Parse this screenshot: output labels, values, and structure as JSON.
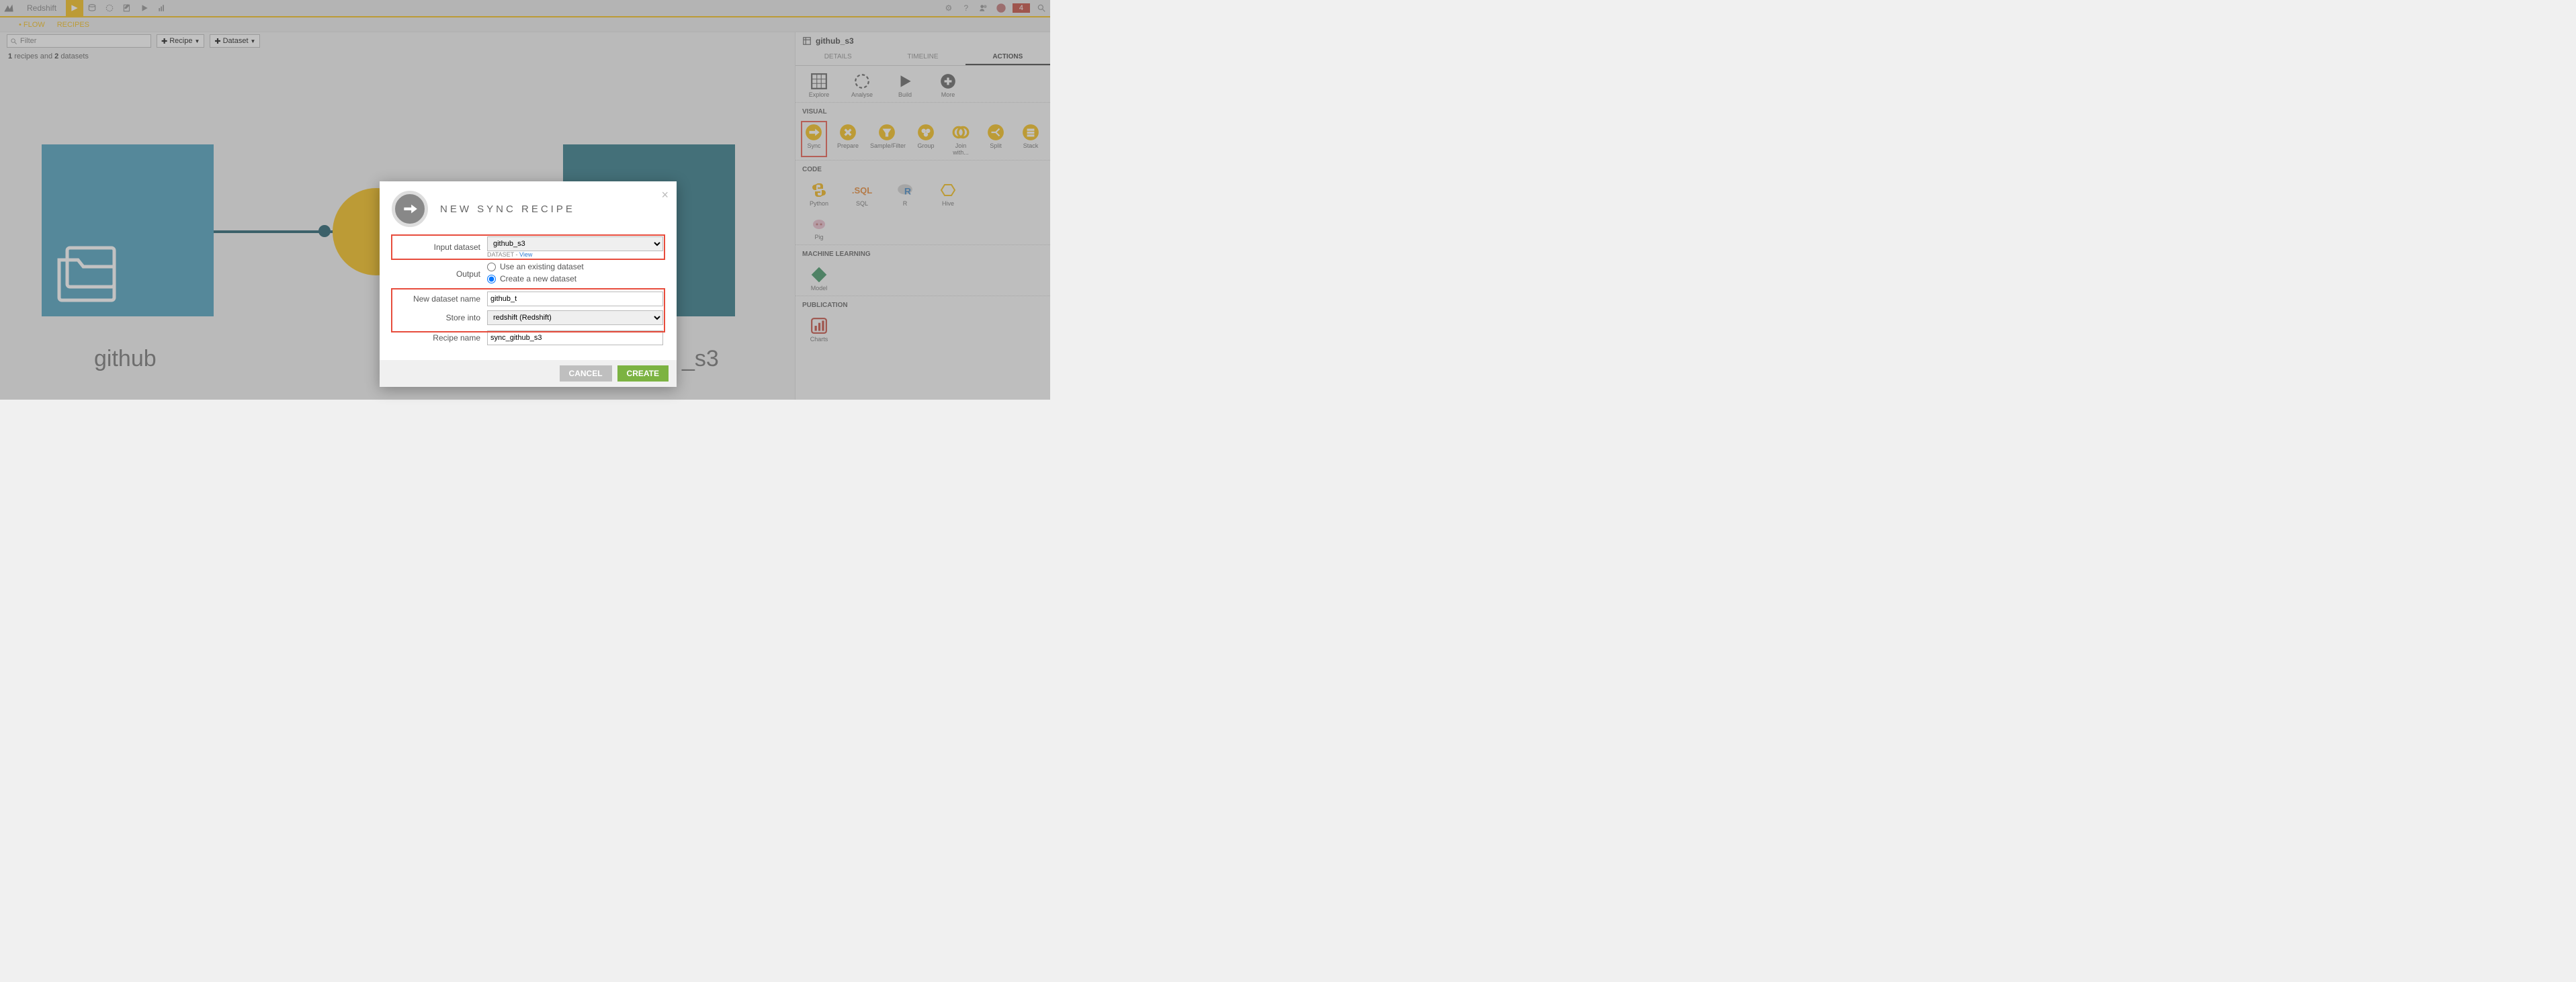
{
  "project": "Redshift",
  "notif_count": "4",
  "subnav": {
    "flow": "FLOW",
    "recipes": "RECIPES"
  },
  "toolbar": {
    "filter_placeholder": "Filter",
    "recipe_btn": "Recipe",
    "dataset_btn": "Dataset"
  },
  "counts": {
    "recipes": "1",
    "recipes_word": "recipes and",
    "datasets": "2",
    "datasets_word": "datasets"
  },
  "flow": {
    "node1_label": "github",
    "node2_label": "_s3"
  },
  "panel": {
    "title": "github_s3",
    "tabs": {
      "details": "DETAILS",
      "timeline": "TIMELINE",
      "actions": "ACTIONS"
    },
    "top_actions": {
      "explore": "Explore",
      "analyse": "Analyse",
      "build": "Build",
      "more": "More"
    },
    "visual_header": "VISUAL",
    "visual": {
      "sync": "Sync",
      "prepare": "Prepare",
      "sample": "Sample/Filter",
      "group": "Group",
      "join": "Join with...",
      "split": "Split",
      "stack": "Stack"
    },
    "code_header": "CODE",
    "code": {
      "python": "Python",
      "sql": "SQL",
      "r": "R",
      "hive": "Hive",
      "pig": "Pig"
    },
    "ml_header": "MACHINE LEARNING",
    "ml": {
      "model": "Model"
    },
    "pub_header": "PUBLICATION",
    "pub": {
      "charts": "Charts"
    }
  },
  "modal": {
    "title": "NEW SYNC RECIPE",
    "input_label": "Input dataset",
    "input_value": "github_s3",
    "input_sub_prefix": "DATASET - ",
    "input_sub_link": "View",
    "output_label": "Output",
    "opt_existing": "Use an existing dataset",
    "opt_create": "Create a new dataset",
    "newname_label": "New dataset name",
    "newname_value": "github_t",
    "store_label": "Store into",
    "store_value": "redshift (Redshift)",
    "recipe_label": "Recipe name",
    "recipe_value": "sync_github_s3",
    "cancel": "CANCEL",
    "create": "CREATE"
  }
}
